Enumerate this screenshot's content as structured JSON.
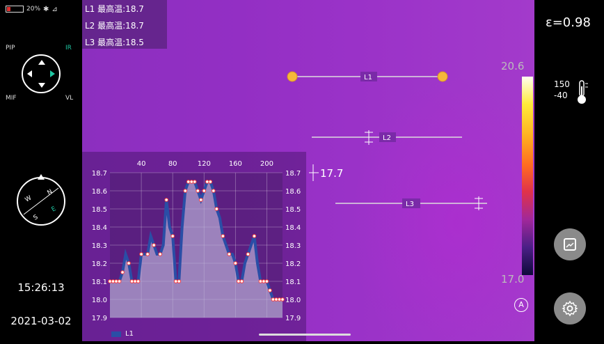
{
  "status": {
    "battery": "20%"
  },
  "modes": {
    "pip": "PIP",
    "ir": "IR",
    "mif": "MIF",
    "vl": "VL"
  },
  "compass_letters": {
    "north": "N",
    "west": "W",
    "east": "E",
    "south": "S"
  },
  "clock": {
    "time": "15:26:13",
    "date": "2021-03-02"
  },
  "readouts": [
    "L1 最高温:18.7",
    "L2 最高温:18.7",
    "L3 最高温:18.5"
  ],
  "lines": [
    {
      "label": "L1"
    },
    {
      "label": "L2"
    },
    {
      "label": "L3"
    }
  ],
  "cursor_value": "17.7",
  "emissivity": "ε=0.98",
  "temperature_scale": {
    "max": "20.6",
    "min": "17.0"
  },
  "range": {
    "high": "150",
    "low": "-40"
  },
  "auto_label": "A",
  "colors": {
    "accent": "#1fc7a3",
    "series": "#2a4ea6",
    "marker": "#ff3b3b",
    "endpoint": "#f5b83a"
  },
  "icons": {
    "gallery": "gallery-icon",
    "settings": "gear-icon",
    "thermometer": "thermometer-icon"
  },
  "chart_data": {
    "type": "area",
    "x_ticks": [
      40,
      80,
      120,
      160,
      200
    ],
    "y_ticks": [
      18.7,
      18.6,
      18.5,
      18.4,
      18.3,
      18.2,
      18.1,
      18.0,
      17.9
    ],
    "ylim": [
      17.9,
      18.7
    ],
    "xlim": [
      0,
      220
    ],
    "series": [
      {
        "name": "L1",
        "x": [
          0,
          4,
          8,
          12,
          16,
          20,
          24,
          28,
          32,
          36,
          40,
          44,
          48,
          52,
          56,
          60,
          64,
          68,
          72,
          76,
          80,
          84,
          88,
          92,
          96,
          100,
          104,
          108,
          112,
          116,
          120,
          124,
          128,
          132,
          136,
          140,
          144,
          148,
          152,
          156,
          160,
          164,
          168,
          172,
          176,
          180,
          184,
          188,
          192,
          196,
          200,
          204,
          208,
          212,
          216,
          220
        ],
        "values": [
          18.1,
          18.1,
          18.1,
          18.1,
          18.15,
          18.25,
          18.2,
          18.1,
          18.1,
          18.1,
          18.25,
          18.25,
          18.25,
          18.35,
          18.3,
          18.25,
          18.25,
          18.3,
          18.55,
          18.4,
          18.35,
          18.1,
          18.1,
          18.4,
          18.6,
          18.65,
          18.65,
          18.65,
          18.6,
          18.55,
          18.6,
          18.65,
          18.65,
          18.6,
          18.5,
          18.45,
          18.35,
          18.3,
          18.25,
          18.25,
          18.2,
          18.1,
          18.1,
          18.2,
          18.25,
          18.3,
          18.35,
          18.2,
          18.1,
          18.1,
          18.1,
          18.05,
          18.0,
          18.0,
          18.0,
          18.0
        ]
      }
    ]
  }
}
